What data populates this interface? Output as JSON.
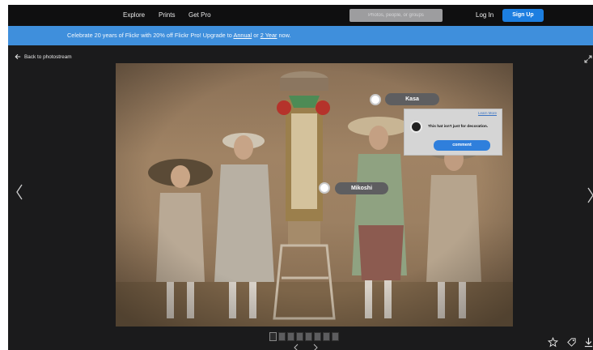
{
  "nav": {
    "explore": "Explore",
    "prints": "Prints",
    "get_pro": "Get Pro",
    "search_placeholder": "Photos, people, or groups",
    "login": "Log In",
    "signup": "Sign Up"
  },
  "banner": {
    "text_before": "Celebrate 20 years of Flickr with 20% off Flickr Pro! Upgrade to ",
    "annual": "Annual",
    "middle": " or ",
    "two_year": "2 Year",
    "text_after": " now."
  },
  "viewer": {
    "back_label": "Back to photostream"
  },
  "tags": [
    {
      "label": "Kasa"
    },
    {
      "label": "Mikoshi"
    }
  ],
  "popup": {
    "learn_more": "Learn More",
    "message": "This hat isn't just for decoration.",
    "comment_button": "comment"
  },
  "icons": {
    "back": "arrow-left-icon",
    "expand": "expand-icon",
    "prev": "chevron-left-icon",
    "next": "chevron-right-icon",
    "favorite": "star-icon",
    "tag": "tag-icon",
    "download": "download-icon"
  },
  "colors": {
    "nav_bg": "#0f0f10",
    "banner_bg": "#3f8fdc",
    "signup_bg": "#1c7ee0",
    "viewer_bg": "#1b1b1c",
    "comment_btn": "#2f7fdc"
  }
}
